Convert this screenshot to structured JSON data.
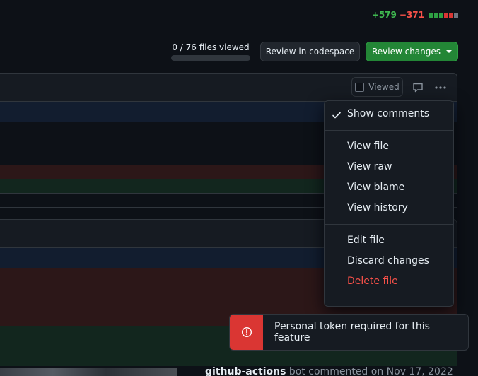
{
  "diffstat": {
    "additions": "+579",
    "deletions": "−371",
    "blocks": [
      "#2ea043",
      "#2ea043",
      "#2ea043",
      "#da3633",
      "#da3633",
      "#6e7681"
    ]
  },
  "progress": {
    "label": "0 / 76 files viewed",
    "fraction": 0.0
  },
  "toolbar": {
    "codespace_label": "Review in codespace",
    "review_label": "Review changes"
  },
  "file_header": {
    "viewed_label": "Viewed"
  },
  "menu": {
    "show_comments": "Show comments",
    "view_file": "View file",
    "view_raw": "View raw",
    "view_blame": "View blame",
    "view_history": "View history",
    "edit_file": "Edit file",
    "discard_changes": "Discard changes",
    "delete_file": "Delete file"
  },
  "toast": {
    "message": "Personal token required for this feature"
  },
  "comment": {
    "author": "github-actions",
    "badge": "bot",
    "meta": "commented on Nov 17, 2022"
  },
  "colors": {
    "accent_green": "#238636",
    "danger": "#f85149",
    "toast_red": "#da3633"
  }
}
